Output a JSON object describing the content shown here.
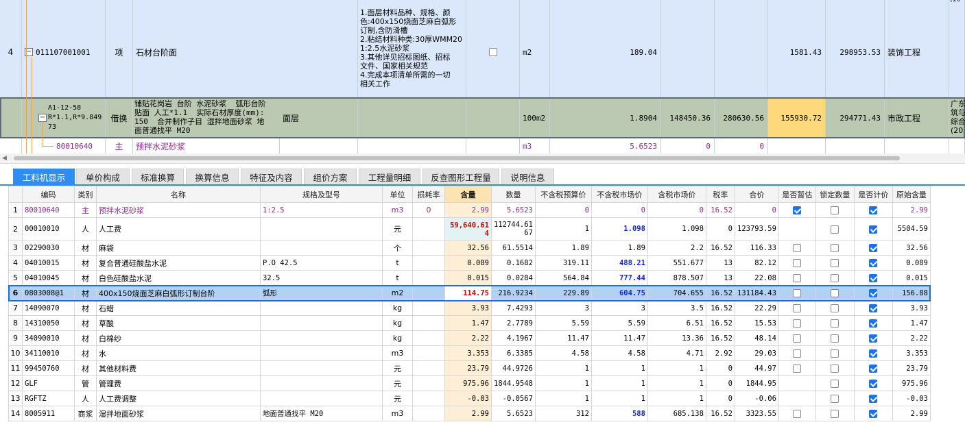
{
  "upper": {
    "prev_row_tail": "(20",
    "item_row": {
      "row_no": "4",
      "code": "011107001001",
      "type": "项",
      "name": "石材台阶面",
      "description": "1.面层材料品种、规格、颜\n色:400x150烧面芝麻白弧形\n订制,含防滑槽\n2.粘结材料种类:30厚WMM20\n1:2.5水泥砂浆\n3.其他详见招标图纸、招标\n文件、国家相关规范\n4.完成本项清单所需的一切\n相关工作",
      "unit": "m2",
      "quantity": "189.04",
      "unit_price": "1581.43",
      "total": "298953.53",
      "category": "装饰工程"
    },
    "sub_row": {
      "code": "A1-12-58\nR*1.1,R*9.849\n73",
      "type": "借换",
      "name": "铺贴花岗岩 台阶 水泥砂浆  弧形台阶\n贴面 人工*1.1  实际石材厚度(mm):\n150  合并制作子目 湿拌地面砂浆 地\n面普通找平 M20",
      "feature": "面层",
      "unit": "100m2",
      "quantity": "1.8904",
      "v1": "148450.36",
      "v2": "280630.56",
      "highlight": "155930.72",
      "total": "294771.43",
      "category": "市政工程",
      "note": "广东\n筑与\n综合\n(20"
    },
    "mat_row": {
      "code": "80010640",
      "type": "主",
      "name": "预拌水泥砂浆",
      "unit": "m3",
      "quantity": "5.6523",
      "v1": "0",
      "v2": "0"
    }
  },
  "tabs": [
    {
      "label": "工料机显示",
      "active": true
    },
    {
      "label": "单价构成"
    },
    {
      "label": "标准换算"
    },
    {
      "label": "换算信息"
    },
    {
      "label": "特征及内容"
    },
    {
      "label": "组价方案"
    },
    {
      "label": "工程量明细"
    },
    {
      "label": "反查图形工程量"
    },
    {
      "label": "说明信息"
    }
  ],
  "table": {
    "headers": [
      "编码",
      "类别",
      "名称",
      "规格及型号",
      "单位",
      "损耗率",
      "含量",
      "数量",
      "不含税预算价",
      "不含税市场价",
      "含税市场价",
      "税率",
      "合价",
      "是否暂估",
      "锁定数量",
      "是否计价",
      "原始含量"
    ],
    "rows": [
      {
        "no": "1",
        "code": "80010640",
        "type": "主",
        "name": "预拌水泥砂浆",
        "spec": "1:2.5",
        "unit": "m3",
        "loss": "0",
        "content": "2.99",
        "qty": "5.6523",
        "budget": "0",
        "market": "0",
        "market_tax": "0",
        "tax": "16.52",
        "amount": "0",
        "est": true,
        "lock": false,
        "priced": true,
        "orig": "2.99"
      },
      {
        "no": "2",
        "code": "00010010",
        "type": "人",
        "name": "人工费",
        "spec": "",
        "unit": "元",
        "loss": "",
        "content": "59,640.61\n4",
        "qty": "112744.61\n67",
        "budget": "1",
        "market": "1.098",
        "market_tax": "1.098",
        "tax": "0",
        "amount": "123793.59",
        "est": null,
        "lock": false,
        "priced": true,
        "orig": "5504.59"
      },
      {
        "no": "3",
        "code": "02290030",
        "type": "材",
        "name": "麻袋",
        "spec": "",
        "unit": "个",
        "loss": "",
        "content": "32.56",
        "qty": "61.5514",
        "budget": "1.89",
        "market": "1.89",
        "market_tax": "2.2",
        "tax": "16.52",
        "amount": "116.33",
        "est": false,
        "lock": false,
        "priced": true,
        "orig": "32.56"
      },
      {
        "no": "4",
        "code": "04010015",
        "type": "材",
        "name": "复合普通硅酸盐水泥",
        "spec": "P.O 42.5",
        "unit": "t",
        "loss": "",
        "content": "0.089",
        "qty": "0.1682",
        "budget": "319.11",
        "market": "488.21",
        "market_tax": "551.677",
        "tax": "13",
        "amount": "82.12",
        "est": false,
        "lock": false,
        "priced": true,
        "orig": "0.089"
      },
      {
        "no": "5",
        "code": "04010045",
        "type": "材",
        "name": "白色硅酸盐水泥",
        "spec": "32.5",
        "unit": "t",
        "loss": "",
        "content": "0.015",
        "qty": "0.0284",
        "budget": "564.84",
        "market": "777.44",
        "market_tax": "878.507",
        "tax": "13",
        "amount": "22.08",
        "est": false,
        "lock": false,
        "priced": true,
        "orig": "0.015"
      },
      {
        "no": "6",
        "code": "0803008@1",
        "type": "材",
        "name": "400x150烧面芝麻白弧形订制台阶",
        "spec": "弧形",
        "unit": "m2",
        "loss": "",
        "content": "114.75",
        "qty": "216.9234",
        "budget": "229.89",
        "market": "604.75",
        "market_tax": "704.655",
        "tax": "16.52",
        "amount": "131184.43",
        "est": false,
        "lock": false,
        "priced": true,
        "orig": "156.88"
      },
      {
        "no": "7",
        "code": "14090070",
        "type": "材",
        "name": "石蜡",
        "spec": "",
        "unit": "kg",
        "loss": "",
        "content": "3.93",
        "qty": "7.4293",
        "budget": "3",
        "market": "3",
        "market_tax": "3.5",
        "tax": "16.52",
        "amount": "22.29",
        "est": false,
        "lock": false,
        "priced": true,
        "orig": "3.93"
      },
      {
        "no": "8",
        "code": "14310050",
        "type": "材",
        "name": "草酸",
        "spec": "",
        "unit": "kg",
        "loss": "",
        "content": "1.47",
        "qty": "2.7789",
        "budget": "5.59",
        "market": "5.59",
        "market_tax": "6.51",
        "tax": "16.52",
        "amount": "15.53",
        "est": false,
        "lock": false,
        "priced": true,
        "orig": "1.47"
      },
      {
        "no": "9",
        "code": "34090010",
        "type": "材",
        "name": "白棉纱",
        "spec": "",
        "unit": "kg",
        "loss": "",
        "content": "2.22",
        "qty": "4.1967",
        "budget": "11.47",
        "market": "11.47",
        "market_tax": "13.36",
        "tax": "16.52",
        "amount": "48.14",
        "est": false,
        "lock": false,
        "priced": true,
        "orig": "2.22"
      },
      {
        "no": "10",
        "code": "34110010",
        "type": "材",
        "name": "水",
        "spec": "",
        "unit": "m3",
        "loss": "",
        "content": "3.353",
        "qty": "6.3385",
        "budget": "4.58",
        "market": "4.58",
        "market_tax": "4.71",
        "tax": "2.92",
        "amount": "29.03",
        "est": false,
        "lock": false,
        "priced": true,
        "orig": "3.353"
      },
      {
        "no": "11",
        "code": "99450760",
        "type": "材",
        "name": "其他材料费",
        "spec": "",
        "unit": "元",
        "loss": "",
        "content": "23.79",
        "qty": "44.9726",
        "budget": "1",
        "market": "1",
        "market_tax": "1",
        "tax": "0",
        "amount": "44.97",
        "est": false,
        "lock": false,
        "priced": true,
        "orig": "23.79"
      },
      {
        "no": "12",
        "code": "GLF",
        "type": "管",
        "name": "管理费",
        "spec": "",
        "unit": "元",
        "loss": "",
        "content": "975.96",
        "qty": "1844.9548",
        "budget": "1",
        "market": "1",
        "market_tax": "1",
        "tax": "0",
        "amount": "1844.95",
        "est": null,
        "lock": false,
        "priced": true,
        "orig": "975.96"
      },
      {
        "no": "13",
        "code": "RGFTZ",
        "type": "人",
        "name": "人工费调整",
        "spec": "",
        "unit": "元",
        "loss": "",
        "content": "-0.03",
        "qty": "-0.0567",
        "budget": "1",
        "market": "1",
        "market_tax": "1",
        "tax": "0",
        "amount": "-0.06",
        "est": null,
        "lock": false,
        "priced": true,
        "orig": "-0.03"
      },
      {
        "no": "14",
        "code": "8005911",
        "type": "商浆",
        "name": "湿拌地面砂浆",
        "spec": "地面普通找平 M20",
        "unit": "m3",
        "loss": "",
        "content": "2.99",
        "qty": "5.6523",
        "budget": "312",
        "market": "588",
        "market_tax": "685.138",
        "tax": "16.52",
        "amount": "3323.55",
        "est": false,
        "lock": false,
        "priced": true,
        "orig": "2.99"
      }
    ]
  },
  "colors": {
    "accent": "#2f8df1",
    "item_row_bg": "#dbe8fb",
    "sub_row_bg": "#bbc9b2",
    "highlight_cell": "#fdd97c",
    "purple_text": "#8b2b8b",
    "blue_value": "#1428d6",
    "red_value": "#d10000"
  }
}
